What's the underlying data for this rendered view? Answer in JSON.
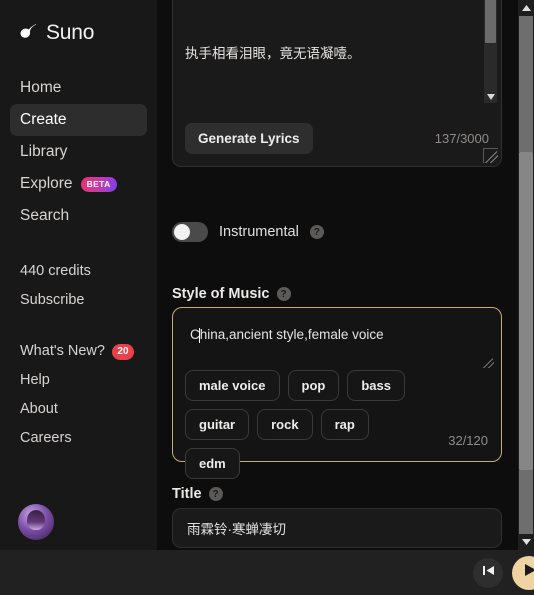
{
  "brand": {
    "name": "Suno",
    "logo_icon": "suno-note-logo"
  },
  "sidebar": {
    "nav_items": [
      {
        "label": "Home",
        "active": false
      },
      {
        "label": "Create",
        "active": true
      },
      {
        "label": "Library",
        "active": false
      },
      {
        "label": "Explore",
        "active": false,
        "badge": "BETA"
      },
      {
        "label": "Search",
        "active": false
      }
    ],
    "account": {
      "credits": "440 credits",
      "subscribe": "Subscribe"
    },
    "footer_items": [
      {
        "label": "What's New?",
        "badge": "20"
      },
      {
        "label": "Help"
      },
      {
        "label": "About"
      },
      {
        "label": "Careers"
      }
    ]
  },
  "lyrics": {
    "text": "都门帐饮无绪，留恋处，兰舟催发。\n\n执手相看泪眼，竟无语凝噎。\n\n念去去，千里烟波，暮霭沉沉楚天阔。\n\n多情自古伤离别，更那堪，冷落清秋节！\n\n今宵酒醒何处？杨柳岸，晓风残月。",
    "generate_button": "Generate Lyrics",
    "char_count": "137/3000"
  },
  "instrumental": {
    "label": "Instrumental",
    "enabled": false,
    "help": "?"
  },
  "style": {
    "label": "Style of Music",
    "help": "?",
    "value": "China,ancient style,female voice",
    "char_count": "32/120",
    "suggestions": [
      "male voice",
      "pop",
      "bass",
      "guitar",
      "rock",
      "rap",
      "edm"
    ]
  },
  "title": {
    "label": "Title",
    "help": "?",
    "value": "雨霖铃·寒蝉凄切"
  },
  "player": {
    "prev_icon": "skip-previous-icon",
    "play_icon": "play-icon"
  },
  "colors": {
    "accent": "#c9ab78",
    "play_button": "#f0d3a3",
    "badge_red": "#e8414a",
    "beta_gradient_start": "#e8336d",
    "beta_gradient_end": "#7b3ff0",
    "sidebar_bg": "#181818",
    "main_bg": "#0d0d0d"
  }
}
